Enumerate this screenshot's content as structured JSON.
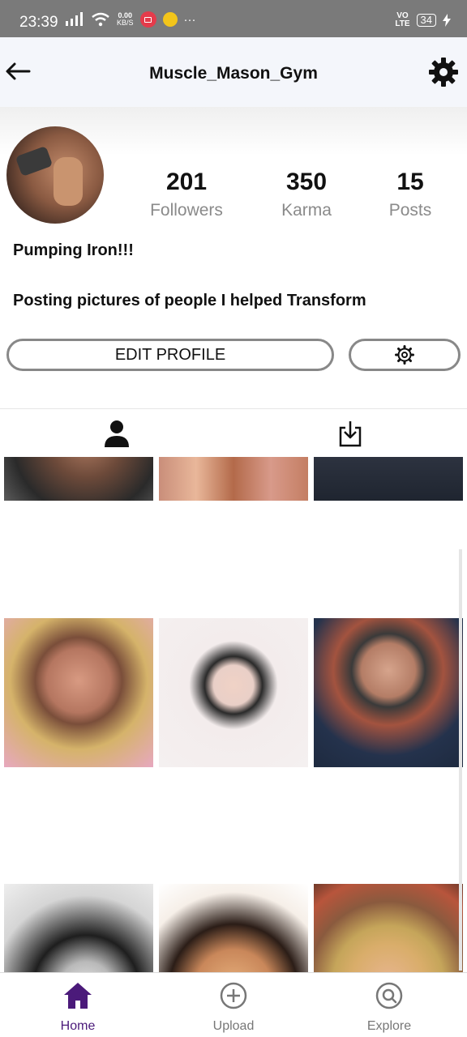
{
  "status_bar": {
    "time": "23:39",
    "net_speed_value": "0.00",
    "net_speed_unit": "KB/S",
    "network_type_top": "VO",
    "network_type_bottom": "LTE",
    "battery_level": "34",
    "more_indicator": "···"
  },
  "header": {
    "title": "Muscle_Mason_Gym",
    "back_icon": "arrow-left-icon",
    "settings_icon": "gear-icon"
  },
  "profile": {
    "stats": [
      {
        "value": "201",
        "label": "Followers"
      },
      {
        "value": "350",
        "label": "Karma"
      },
      {
        "value": "15",
        "label": "Posts"
      }
    ],
    "bio_line1": "Pumping Iron!!!",
    "bio_line2": "Posting pictures of people I helped Transform",
    "edit_button_label": "EDIT PROFILE"
  },
  "tabs": [
    {
      "name": "posts",
      "icon": "person-icon"
    },
    {
      "name": "saved",
      "icon": "download-icon"
    }
  ],
  "bottom_nav": [
    {
      "label": "Home",
      "icon": "home-icon",
      "active": true
    },
    {
      "label": "Upload",
      "icon": "plus-circle-icon",
      "active": false
    },
    {
      "label": "Explore",
      "icon": "search-circle-icon",
      "active": false
    }
  ],
  "colors": {
    "accent": "#4b1a7a",
    "inactive": "#777777",
    "status_bar": "#7a7a7a"
  }
}
